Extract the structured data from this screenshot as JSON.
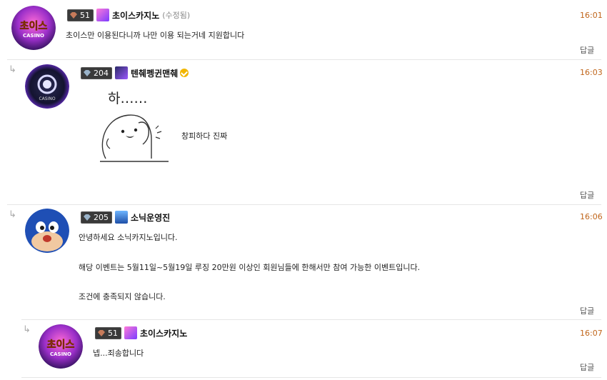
{
  "comments": [
    {
      "level": "51",
      "nickname": "초이스카지노",
      "edited": "(수정됨)",
      "time": "16:01",
      "lines": [
        "초이스만 이용된다니까 나만 이용 되는거네 지원합니다"
      ],
      "reply": "답글"
    },
    {
      "level": "204",
      "nickname": "텐췌펭귄맨췌",
      "time": "16:03",
      "sticker_text": "하……",
      "lines": [
        "창피하다 진짜"
      ],
      "reply": "답글"
    },
    {
      "level": "205",
      "nickname": "소닉운영진",
      "time": "16:06",
      "lines": [
        "안녕하세요 소닉카지노입니다.",
        "해당 이벤트는 5월11일~5월19일 루징 20만원 이상인 회원님들에 한해서만 참여 가능한 이벤트입니다.",
        "조건에 충족되지 않습니다."
      ],
      "reply": "답글"
    },
    {
      "level": "51",
      "nickname": "초이스카지노",
      "time": "16:07",
      "lines": [
        "넵...죄송합니다"
      ],
      "reply": "답글"
    }
  ],
  "colors": {
    "time": "#c0651a",
    "verified": "#f2b600"
  }
}
